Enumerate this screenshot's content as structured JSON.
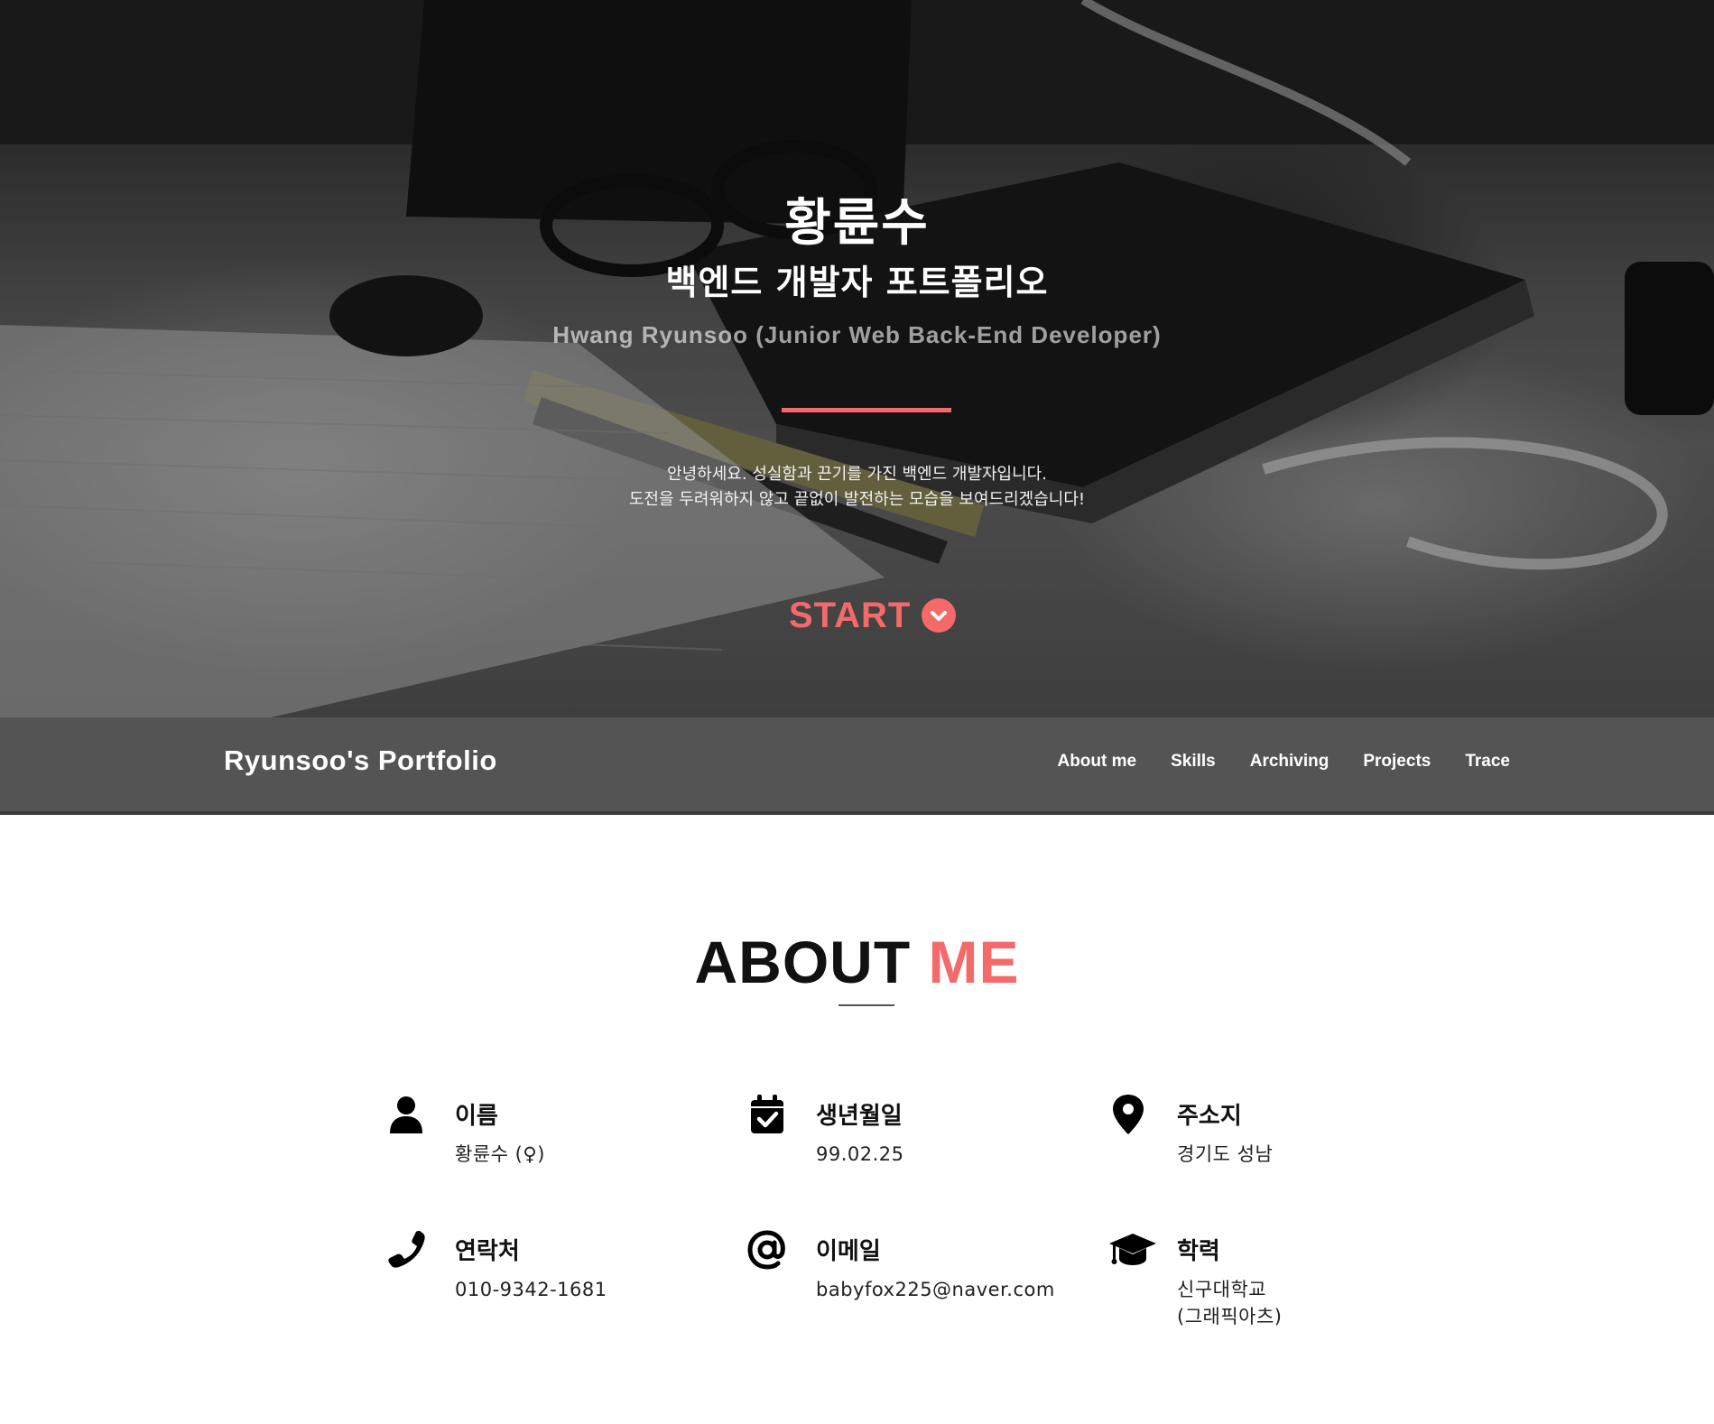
{
  "hero": {
    "name": "황륜수",
    "subtitle": "백엔드 개발자 포트폴리오",
    "english": "Hwang Ryunsoo (Junior Web Back-End Developer)",
    "intro_line1": "안녕하세요. 성실함과 끈기를 가진 백엔드 개발자입니다.",
    "intro_line2": "도전을 두려워하지 않고 끝없이 발전하는 모습을 보여드리겠습니다!",
    "start_label": "START"
  },
  "navbar": {
    "brand": "Ryunsoo's Portfolio",
    "links": [
      "About me",
      "Skills",
      "Archiving",
      "Projects",
      "Trace"
    ]
  },
  "about": {
    "title_main": "ABOUT",
    "title_accent": "ME",
    "items": [
      {
        "icon": "user-icon",
        "label": "이름",
        "value": "황륜수 (♀)"
      },
      {
        "icon": "calendar-check-icon",
        "label": "생년월일",
        "value": "99.02.25"
      },
      {
        "icon": "map-pin-icon",
        "label": "주소지",
        "value": "경기도 성남"
      },
      {
        "icon": "phone-icon",
        "label": "연락처",
        "value": "010-9342-1681"
      },
      {
        "icon": "at-sign-icon",
        "label": "이메일",
        "value": "babyfox225@naver.com"
      },
      {
        "icon": "graduation-cap-icon",
        "label": "학력",
        "value_line1": "신구대학교",
        "value_line2": "(그래픽아츠)"
      }
    ]
  },
  "colors": {
    "accent": "#f46a6a",
    "navbar": "#545454"
  }
}
